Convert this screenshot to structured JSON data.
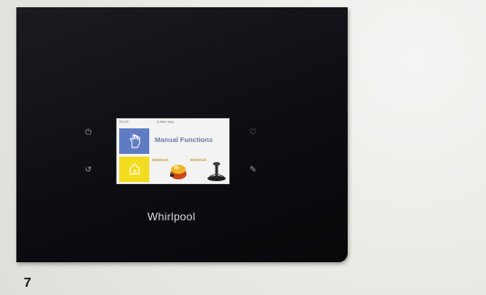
{
  "icons": {
    "left_top": "power-icon",
    "left_bottom": "back-icon",
    "right_top": "heart-icon",
    "right_bottom": "edit-icon",
    "manual_tile": "hand-icon",
    "yellow_tile": "home-icon",
    "card1": "pan-icon",
    "card2": "kettle-icon"
  },
  "display": {
    "status_time": "08:43",
    "status_title": "A little help",
    "manual_label": "Manual Functions",
    "card1": {
      "name": "BREKKIE",
      "sub": "",
      "color": "#c79b2c"
    },
    "card2": {
      "name": "BREKKIE",
      "sub": ""
    }
  },
  "colors": {
    "manual_tile": "#5f7cc3",
    "yellow_tile": "#f2dc1f",
    "cooktop": "#0d0e12"
  },
  "brand": {
    "logo": "Whirlpool"
  },
  "caption": {
    "page_number": "7"
  }
}
